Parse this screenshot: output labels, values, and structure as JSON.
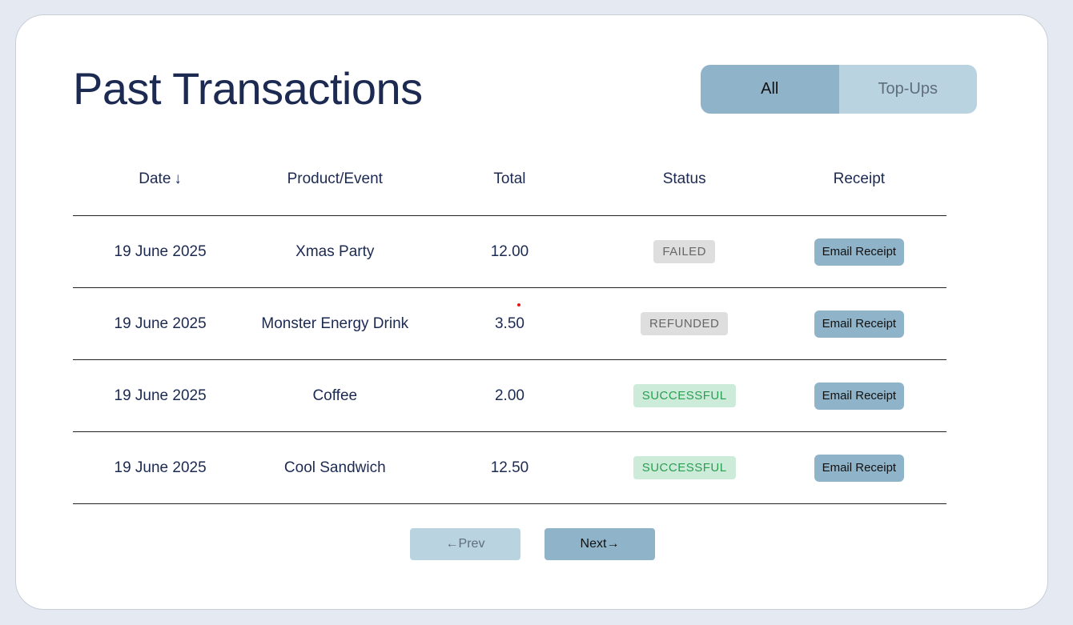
{
  "page": {
    "title": "Past Transactions"
  },
  "filter_toggle": {
    "options": [
      {
        "label": "All",
        "active": true
      },
      {
        "label": "Top-Ups",
        "active": false
      }
    ]
  },
  "table": {
    "columns": [
      "Date",
      "Product/Event",
      "Total",
      "Status",
      "Receipt"
    ],
    "sort_indicator": "↓",
    "rows": [
      {
        "date": "19 June 2025",
        "product": "Xmas Party",
        "total": "12.00",
        "status": "FAILED",
        "receipt": "Email Receipt"
      },
      {
        "date": "19 June 2025",
        "product": "Monster Energy Drink",
        "total": "3.50",
        "status": "REFUNDED",
        "receipt": "Email Receipt"
      },
      {
        "date": "19 June 2025",
        "product": "Coffee",
        "total": "2.00",
        "status": "SUCCESSFUL",
        "receipt": "Email Receipt"
      },
      {
        "date": "19 June 2025",
        "product": "Cool Sandwich",
        "total": "12.50",
        "status": "SUCCESSFUL",
        "receipt": "Email Receipt"
      }
    ]
  },
  "status_colors": {
    "FAILED": {
      "bg": "#dedede",
      "fg": "#666666"
    },
    "REFUNDED": {
      "bg": "#dedede",
      "fg": "#666666"
    },
    "SUCCESSFUL": {
      "bg": "#cdebd9",
      "fg": "#2a9e52"
    }
  },
  "pagination": {
    "prev_label": "←Prev",
    "next_label": "Next→"
  },
  "colors": {
    "background": "#e5e9f1",
    "card": "#ffffff",
    "title": "#1c2a52",
    "accent": "#8fb3c9",
    "accent_light": "#b9d3e0"
  }
}
